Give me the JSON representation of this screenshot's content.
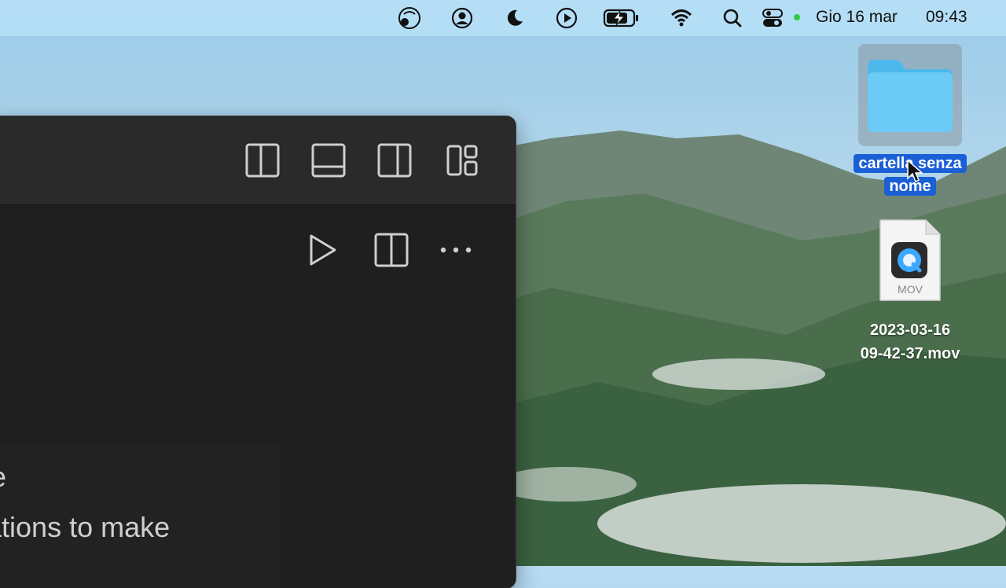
{
  "menubar": {
    "date": "Gio 16 mar",
    "time": "09:43",
    "icons": [
      "screen-mirroring-icon",
      "user-account-icon",
      "moon-icon",
      "play-circle-icon",
      "battery-charging-icon",
      "wifi-icon",
      "search-icon",
      "control-center-icon"
    ],
    "status_dot_color": "#2ecc40"
  },
  "window": {
    "titlebar_buttons": [
      "toggle-primary-sidebar-icon",
      "toggle-panel-icon",
      "toggle-secondary-sidebar-icon",
      "customize-layout-icon"
    ],
    "editor_buttons": [
      "run-icon",
      "split-editor-icon",
      "more-actions-icon"
    ],
    "welcome_title_fragment": "e",
    "welcome_sub_fragment": "ations to make"
  },
  "desktop": {
    "folder_name_line1": "cartella senza",
    "folder_name_line2": "nome",
    "file_type": "MOV",
    "file_name_line1": "2023-03-16",
    "file_name_line2": "09-42-37.mov"
  }
}
